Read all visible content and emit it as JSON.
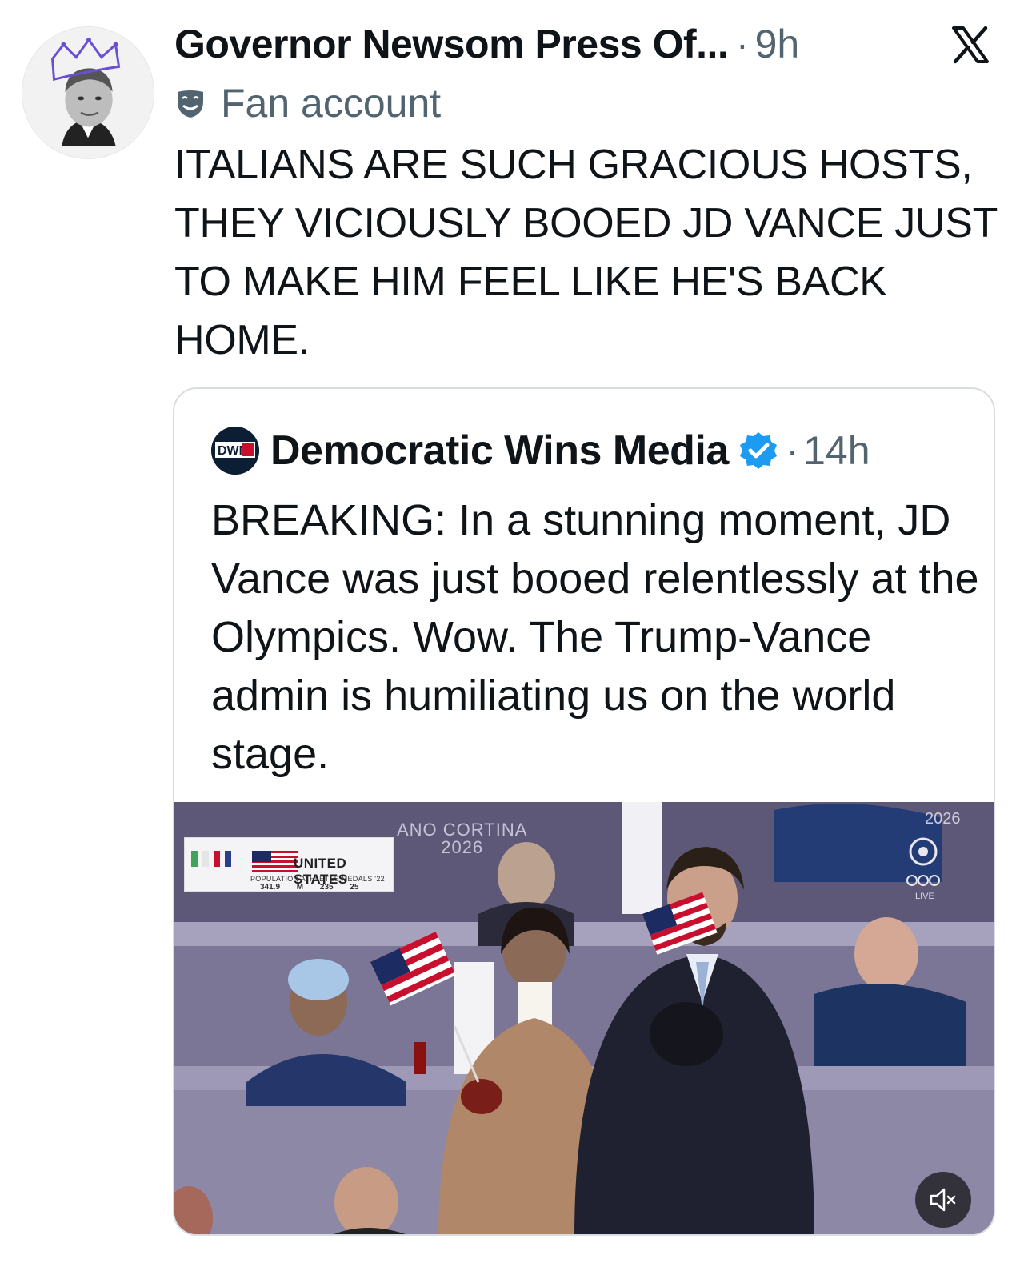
{
  "tweet": {
    "author_name": "Governor Newsom Press Of...",
    "separator": "·",
    "time": "9h",
    "badge_label": "Fan account",
    "text": "ITALIANS ARE SUCH GRACIOUS HOSTS, THEY VICIOUSLY BOOED JD VANCE JUST TO MAKE HIM FEEL LIKE HE'S BACK HOME."
  },
  "icons": {
    "platform": "x-logo-icon",
    "badge": "theater-mask-icon",
    "verified": "verified-badge-icon",
    "mute": "speaker-muted-icon"
  },
  "quoted_tweet": {
    "avatar_text": "DWM",
    "author_name": "Democratic Wins Media",
    "separator": "·",
    "time": "14h",
    "text": "BREAKING: In a stunning moment, JD Vance was just booed relentlessly at the Olympics. Wow. The Trump-Vance admin is humiliating us on the world stage."
  },
  "video": {
    "venue_line1": "ANO CORTINA",
    "venue_line2": "2026",
    "corner_year": "2026",
    "live_label": "LIVE",
    "scoreboard": {
      "country": "UNITED STATES",
      "labels": "POPULATION  ATHLETES  MEDALS '22",
      "values": "341.9 M 235 25"
    }
  },
  "colors": {
    "text_primary": "#0f1419",
    "text_secondary": "#536471",
    "verified_blue": "#1d9bf0",
    "card_border": "#d9dde1"
  }
}
